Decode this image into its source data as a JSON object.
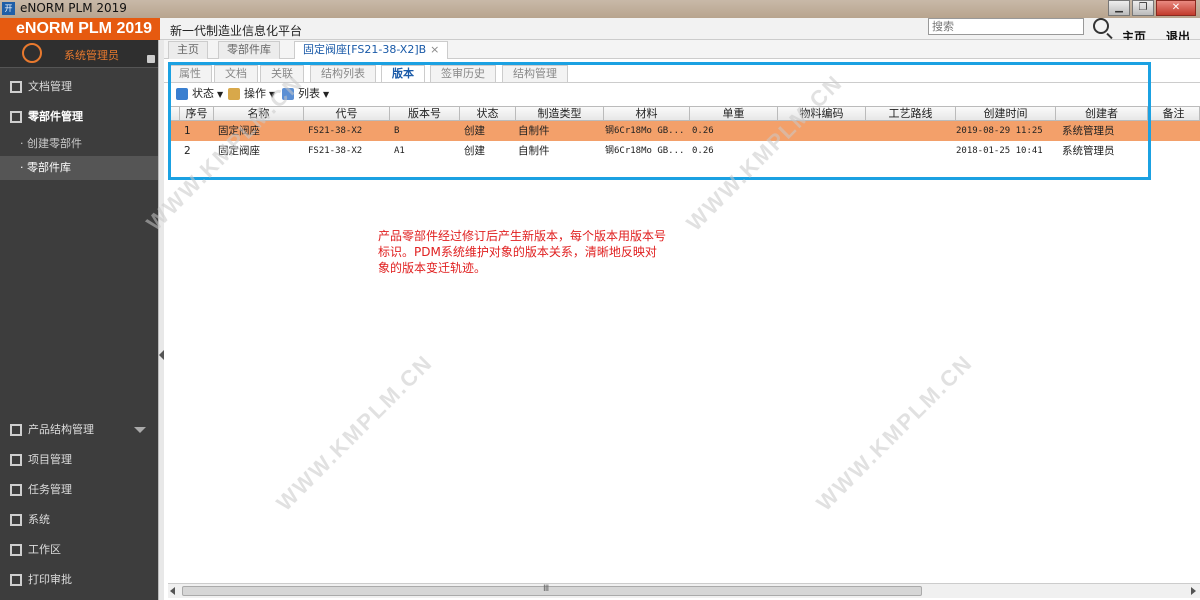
{
  "window": {
    "title": "eNORM PLM 2019",
    "app_icon_text": "开",
    "controls": [
      "▁",
      "❐",
      "✕"
    ]
  },
  "header": {
    "brand": "eNORM PLM 2019",
    "slogan": "新一代制造业信息化平台",
    "search_placeholder": "搜索",
    "home_label": "主页",
    "logout_label": "退出"
  },
  "sidebar": {
    "user": "系统管理员",
    "items_top": [
      {
        "label": "文档管理"
      },
      {
        "label": "零部件管理"
      }
    ],
    "sub_items": [
      {
        "label": "· 创建零部件"
      },
      {
        "label": "· 零部件库"
      }
    ],
    "items_bottom": [
      {
        "label": "产品结构管理"
      },
      {
        "label": "项目管理"
      },
      {
        "label": "任务管理"
      },
      {
        "label": "系统"
      },
      {
        "label": "工作区"
      },
      {
        "label": "打印审批"
      }
    ]
  },
  "tabs": [
    {
      "label": "主页"
    },
    {
      "label": "零部件库"
    },
    {
      "label": "固定阀座[FS21-38-X2]B"
    }
  ],
  "subtabs": [
    {
      "label": "属性"
    },
    {
      "label": "文档"
    },
    {
      "label": "关联"
    },
    {
      "label": "结构列表"
    },
    {
      "label": "版本"
    },
    {
      "label": "签审历史"
    },
    {
      "label": "结构管理"
    }
  ],
  "toolbar": {
    "status": "状态",
    "operation": "操作",
    "list": "列表"
  },
  "grid": {
    "columns": [
      "序号",
      "名称",
      "代号",
      "版本号",
      "状态",
      "制造类型",
      "材料",
      "单重",
      "物料编码",
      "工艺路线",
      "创建时间",
      "创建者",
      "备注"
    ],
    "rows": [
      [
        "1",
        "固定阀座",
        "FS21-38-X2",
        "B",
        "创建",
        "自制件",
        "钢6Cr18Mo GB...",
        "0.26",
        "",
        "",
        "2019-08-29 11:25",
        "系统管理员",
        ""
      ],
      [
        "2",
        "固定阀座",
        "FS21-38-X2",
        "A1",
        "创建",
        "自制件",
        "钢6Cr18Mo GB...",
        "0.26",
        "",
        "",
        "2018-01-25 10:41",
        "系统管理员",
        ""
      ]
    ]
  },
  "annotation": "产品零部件经过修订后产生新版本，每个版本用版本号标识。PDM系统维护对象的版本关系，清晰地反映对象的版本变迁轨迹。",
  "watermark": "WWW.KMPLM.CN",
  "scroll_grip": "Ⅲ",
  "colors": {
    "brand": "#e65a10",
    "sidebar": "#3d3d3d",
    "selected_row": "#f3a06a",
    "frame": "#1ba1e2",
    "annotation": "#e02020"
  }
}
